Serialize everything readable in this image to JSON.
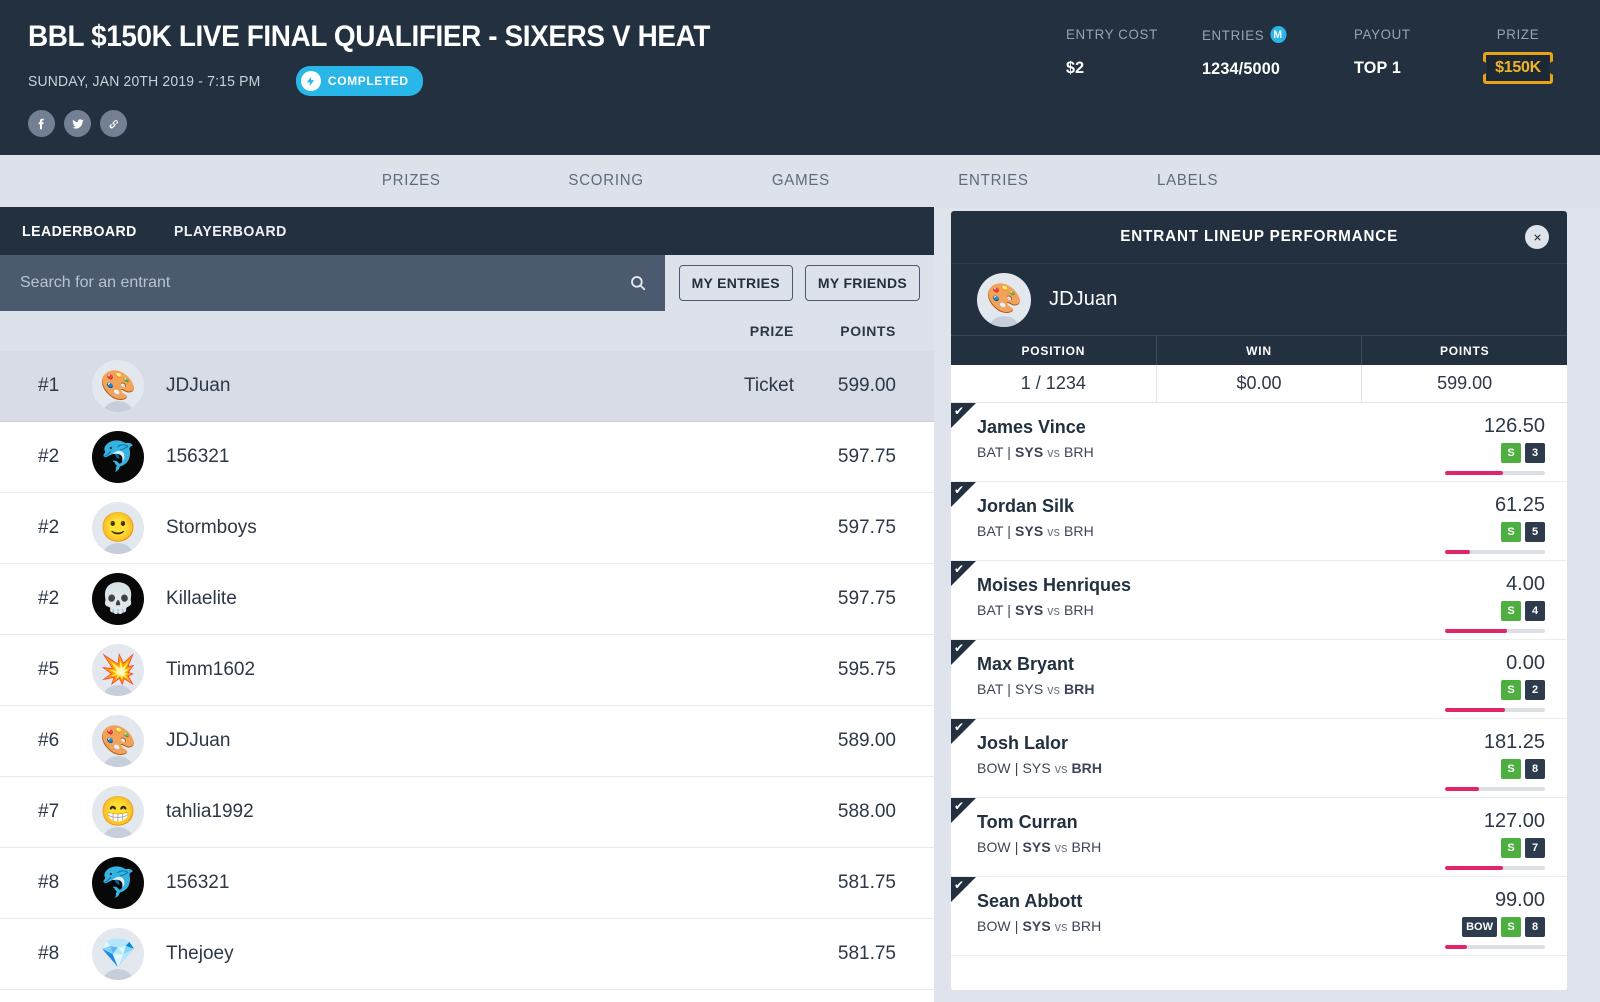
{
  "header": {
    "title": "BBL $150K LIVE FINAL QUALIFIER - SIXERS V HEAT",
    "date": "SUNDAY, JAN 20TH 2019 - 7:15 PM",
    "status": "COMPLETED",
    "status_color": "#29b6e8",
    "socials": [
      {
        "name": "facebook-icon"
      },
      {
        "name": "twitter-icon"
      },
      {
        "name": "link-icon"
      }
    ],
    "stats": [
      {
        "label": "ENTRY COST",
        "value": "$2",
        "badge": null
      },
      {
        "label": "ENTRIES",
        "value": "1234/5000",
        "badge": "M"
      },
      {
        "label": "PAYOUT",
        "value": "TOP 1",
        "badge": null
      },
      {
        "label": "PRIZE",
        "value": "$150K",
        "badge": null
      }
    ]
  },
  "nav": {
    "items": [
      "PRIZES",
      "SCORING",
      "GAMES",
      "ENTRIES",
      "LABELS"
    ]
  },
  "leaderboard": {
    "tabs": [
      "LEADERBOARD",
      "PLAYERBOARD"
    ],
    "active_tab": "LEADERBOARD",
    "search": {
      "placeholder": "Search for an entrant",
      "value": ""
    },
    "buttons": [
      "MY ENTRIES",
      "MY FRIENDS"
    ],
    "columns": {
      "prize": "PRIZE",
      "points": "POINTS"
    },
    "rows": [
      {
        "rank": "#1",
        "name": "JDJuan",
        "prize": "Ticket",
        "points": "599.00",
        "avatar": "palette-avatar",
        "avatar_style": "light",
        "glyph": "🎨",
        "highlight": true
      },
      {
        "rank": "#2",
        "name": "156321",
        "prize": "",
        "points": "597.75",
        "avatar": "dolphin-avatar",
        "avatar_style": "dark",
        "glyph": "🐬",
        "highlight": false
      },
      {
        "rank": "#2",
        "name": "Stormboys",
        "prize": "",
        "points": "597.75",
        "avatar": "smile-avatar",
        "avatar_style": "light",
        "glyph": "🙂",
        "highlight": false
      },
      {
        "rank": "#2",
        "name": "Killaelite",
        "prize": "",
        "points": "597.75",
        "avatar": "skull-avatar",
        "avatar_style": "dark",
        "glyph": "💀",
        "highlight": false
      },
      {
        "rank": "#5",
        "name": "Timm1602",
        "prize": "",
        "points": "595.75",
        "avatar": "explosion-avatar",
        "avatar_style": "light",
        "glyph": "💥",
        "highlight": false
      },
      {
        "rank": "#6",
        "name": "JDJuan",
        "prize": "",
        "points": "589.00",
        "avatar": "palette-avatar",
        "avatar_style": "light",
        "glyph": "🎨",
        "highlight": false
      },
      {
        "rank": "#7",
        "name": "tahlia1992",
        "prize": "",
        "points": "588.00",
        "avatar": "grin-avatar",
        "avatar_style": "light",
        "glyph": "😁",
        "highlight": false
      },
      {
        "rank": "#8",
        "name": "156321",
        "prize": "",
        "points": "581.75",
        "avatar": "dolphin-avatar",
        "avatar_style": "dark",
        "glyph": "🐬",
        "highlight": false
      },
      {
        "rank": "#8",
        "name": "Thejoey",
        "prize": "",
        "points": "581.75",
        "avatar": "gem-avatar",
        "avatar_style": "light",
        "glyph": "💎",
        "highlight": false
      }
    ]
  },
  "lineup_panel": {
    "title": "ENTRANT LINEUP PERFORMANCE",
    "close_label": "✕",
    "entrant": {
      "name": "JDJuan",
      "avatar": "palette-avatar",
      "glyph": "🎨"
    },
    "stats_head": [
      "POSITION",
      "WIN",
      "POINTS"
    ],
    "stats_values": [
      "1 / 1234",
      "$0.00",
      "599.00"
    ],
    "players": [
      {
        "name": "James Vince",
        "role": "BAT",
        "match": "SYS vs BRH",
        "bold_team": "SYS",
        "score": "126.50",
        "badges": [
          {
            "text": "S",
            "style": "green"
          },
          {
            "text": "3",
            "style": "dark"
          }
        ],
        "bar_pct": 58
      },
      {
        "name": "Jordan Silk",
        "role": "BAT",
        "match": "SYS vs BRH",
        "bold_team": "SYS",
        "score": "61.25",
        "badges": [
          {
            "text": "S",
            "style": "green"
          },
          {
            "text": "5",
            "style": "dark"
          }
        ],
        "bar_pct": 25
      },
      {
        "name": "Moises Henriques",
        "role": "BAT",
        "match": "SYS vs BRH",
        "bold_team": "SYS",
        "score": "4.00",
        "badges": [
          {
            "text": "S",
            "style": "green"
          },
          {
            "text": "4",
            "style": "dark"
          }
        ],
        "bar_pct": 62
      },
      {
        "name": "Max Bryant",
        "role": "BAT",
        "match": "SYS vs BRH",
        "bold_team": "BRH",
        "score": "0.00",
        "badges": [
          {
            "text": "S",
            "style": "green"
          },
          {
            "text": "2",
            "style": "dark"
          }
        ],
        "bar_pct": 60
      },
      {
        "name": "Josh Lalor",
        "role": "BOW",
        "match": "SYS vs BRH",
        "bold_team": "BRH",
        "score": "181.25",
        "badges": [
          {
            "text": "S",
            "style": "green"
          },
          {
            "text": "8",
            "style": "dark"
          }
        ],
        "bar_pct": 34
      },
      {
        "name": "Tom Curran",
        "role": "BOW",
        "match": "SYS vs BRH",
        "bold_team": "SYS",
        "score": "127.00",
        "badges": [
          {
            "text": "S",
            "style": "green"
          },
          {
            "text": "7",
            "style": "dark"
          }
        ],
        "bar_pct": 58
      },
      {
        "name": "Sean Abbott",
        "role": "BOW",
        "match": "SYS vs BRH",
        "bold_team": "SYS",
        "score": "99.00",
        "badges": [
          {
            "text": "BOW",
            "style": "dark"
          },
          {
            "text": "S",
            "style": "green"
          },
          {
            "text": "8",
            "style": "dark"
          }
        ],
        "bar_pct": 22
      }
    ]
  }
}
